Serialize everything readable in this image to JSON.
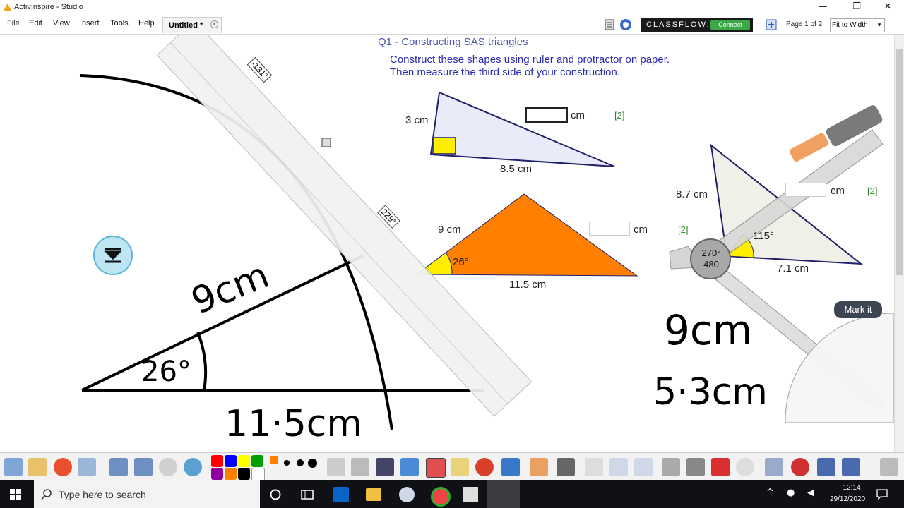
{
  "window": {
    "title": "ActivInspire - Studio",
    "minimize": "—",
    "maximize": "❐",
    "close": "✕"
  },
  "menu": [
    "File",
    "Edit",
    "View",
    "Insert",
    "Tools",
    "Help"
  ],
  "doc_tab": {
    "label": "Untitled *",
    "close": "×"
  },
  "classflow": {
    "brand": "CLASSFLOW:",
    "connect": "Connect"
  },
  "page_info": "Page 1 of 2",
  "zoom": {
    "value": "Fit to Width",
    "arrow": "▾"
  },
  "question": {
    "title": "Q1 - Constructing SAS triangles",
    "line1": "Construct these shapes using ruler and protractor on paper.",
    "line2": "Then measure the third side of your construction."
  },
  "triangle1": {
    "side_a": "3 cm",
    "side_b": "8.5 cm",
    "unit": "cm",
    "marks": "[2]"
  },
  "triangle2": {
    "side_a": "9 cm",
    "side_b": "11.5 cm",
    "angle": "26°",
    "unit": "cm",
    "marks": "[2]"
  },
  "triangle3": {
    "side_a": "8.7 cm",
    "side_b": "7.1 cm",
    "angle": "115°",
    "unit": "cm",
    "marks": "[2]"
  },
  "compass_readout": {
    "angle": "270°",
    "length": "480"
  },
  "ruler_labels": {
    "angle1": "-131°",
    "angle2": "229°"
  },
  "mark_it": "Mark it",
  "handwriting": {
    "side": "9cm",
    "angle": "26°",
    "base": "11·5cm",
    "answer1": "9cm",
    "answer2": "5·3cm"
  },
  "taskbar": {
    "search_placeholder": "Type here to search",
    "time": "12:14",
    "date": "29/12/2020"
  },
  "colors": {
    "accent": "#2b2bb0",
    "orange": "#ff7f00",
    "yellow": "#ffee00",
    "triangle_fill": "#e9ecf8",
    "marks": "#2f8a2f"
  }
}
